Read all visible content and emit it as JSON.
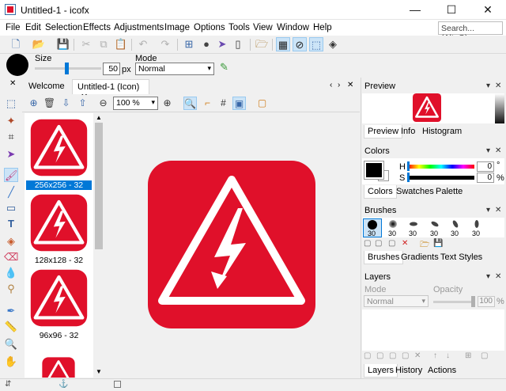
{
  "window": {
    "title": "Untitled-1 - icofx",
    "controls": {
      "minimize": "—",
      "maximize": "☐",
      "close": "✕"
    }
  },
  "menu": [
    "File",
    "Edit",
    "Selection",
    "Effects",
    "Adjustments",
    "Image",
    "Options",
    "Tools",
    "View",
    "Window",
    "Help"
  ],
  "search": {
    "placeholder": "Search... (Alt+Q)"
  },
  "options": {
    "size_label": "Size",
    "size_value": "50",
    "size_unit": "px",
    "size_fraction": 0.5,
    "mode_label": "Mode",
    "mode_value": "Normal"
  },
  "tabs": {
    "welcome": "Welcome",
    "document": "Untitled-1 (Icon)",
    "close": "✕"
  },
  "doc_toolbar": {
    "zoom": "100 %"
  },
  "sizes": [
    {
      "caption": "256x256 - 32"
    },
    {
      "caption": "128x128 - 32"
    },
    {
      "caption": "96x96 - 32"
    }
  ],
  "panels": {
    "preview": {
      "title": "Preview",
      "tabs": [
        "Preview",
        "Info",
        "Histogram"
      ]
    },
    "colors": {
      "title": "Colors",
      "tabs": [
        "Colors",
        "Swatches",
        "Palette"
      ],
      "h_label": "H",
      "s_label": "S",
      "h_value": "0",
      "s_value": "0",
      "h_unit": "°",
      "s_unit": "%"
    },
    "brushes": {
      "title": "Brushes",
      "tabs": [
        "Brushes",
        "Gradients",
        "Text Styles"
      ],
      "sizes": [
        "30",
        "30",
        "30",
        "30",
        "30",
        "30"
      ]
    },
    "layers": {
      "title": "Layers",
      "tabs": [
        "Layers",
        "History",
        "Actions"
      ],
      "mode_label": "Mode",
      "opacity_label": "Opacity",
      "mode_value": "Normal",
      "opacity_value": "100",
      "opacity_unit": "%"
    }
  },
  "colors": {
    "accent": "#e0102a",
    "selection": "#0078d7"
  }
}
